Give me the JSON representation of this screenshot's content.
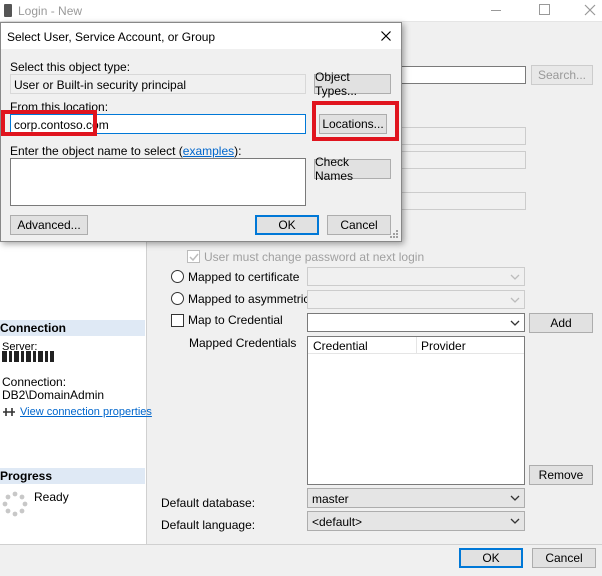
{
  "main_window": {
    "title": "Login - New",
    "search_button": "Search...",
    "user_must_change_password": "User must change password at next login",
    "mapped_to_certificate": "Mapped to certificate",
    "mapped_to_asymmetric_key": "Mapped to asymmetric key",
    "map_to_credential": "Map to Credential",
    "add_button": "Add",
    "mapped_credentials_label": "Mapped Credentials",
    "credentials_columns": [
      "Credential",
      "Provider"
    ],
    "remove_button": "Remove",
    "default_database_label": "Default database:",
    "default_database_value": "master",
    "default_language_label": "Default language:",
    "default_language_value": "<default>",
    "ok_button": "OK",
    "cancel_button": "Cancel"
  },
  "left_panel": {
    "connection_header": "Connection",
    "server_label": "Server:",
    "connection_label": "Connection:",
    "connection_value": "DB2\\DomainAdmin",
    "view_connection_properties": "View connection properties",
    "progress_header": "Progress",
    "progress_status": "Ready"
  },
  "dialog": {
    "title": "Select User, Service Account, or Group",
    "object_type_label": "Select this object type:",
    "object_type_value": "User or Built-in security principal",
    "object_types_button": "Object Types...",
    "location_label": "From this location:",
    "location_value": "corp.contoso.com",
    "locations_button": "Locations...",
    "object_name_label_prefix": "Enter the object name to select (",
    "examples_link": "examples",
    "object_name_label_suffix": "):",
    "check_names_button": "Check Names",
    "advanced_button": "Advanced...",
    "ok_button": "OK",
    "cancel_button": "Cancel"
  },
  "colors": {
    "highlight_red": "#e0141e",
    "accent_blue": "#0078d7"
  }
}
